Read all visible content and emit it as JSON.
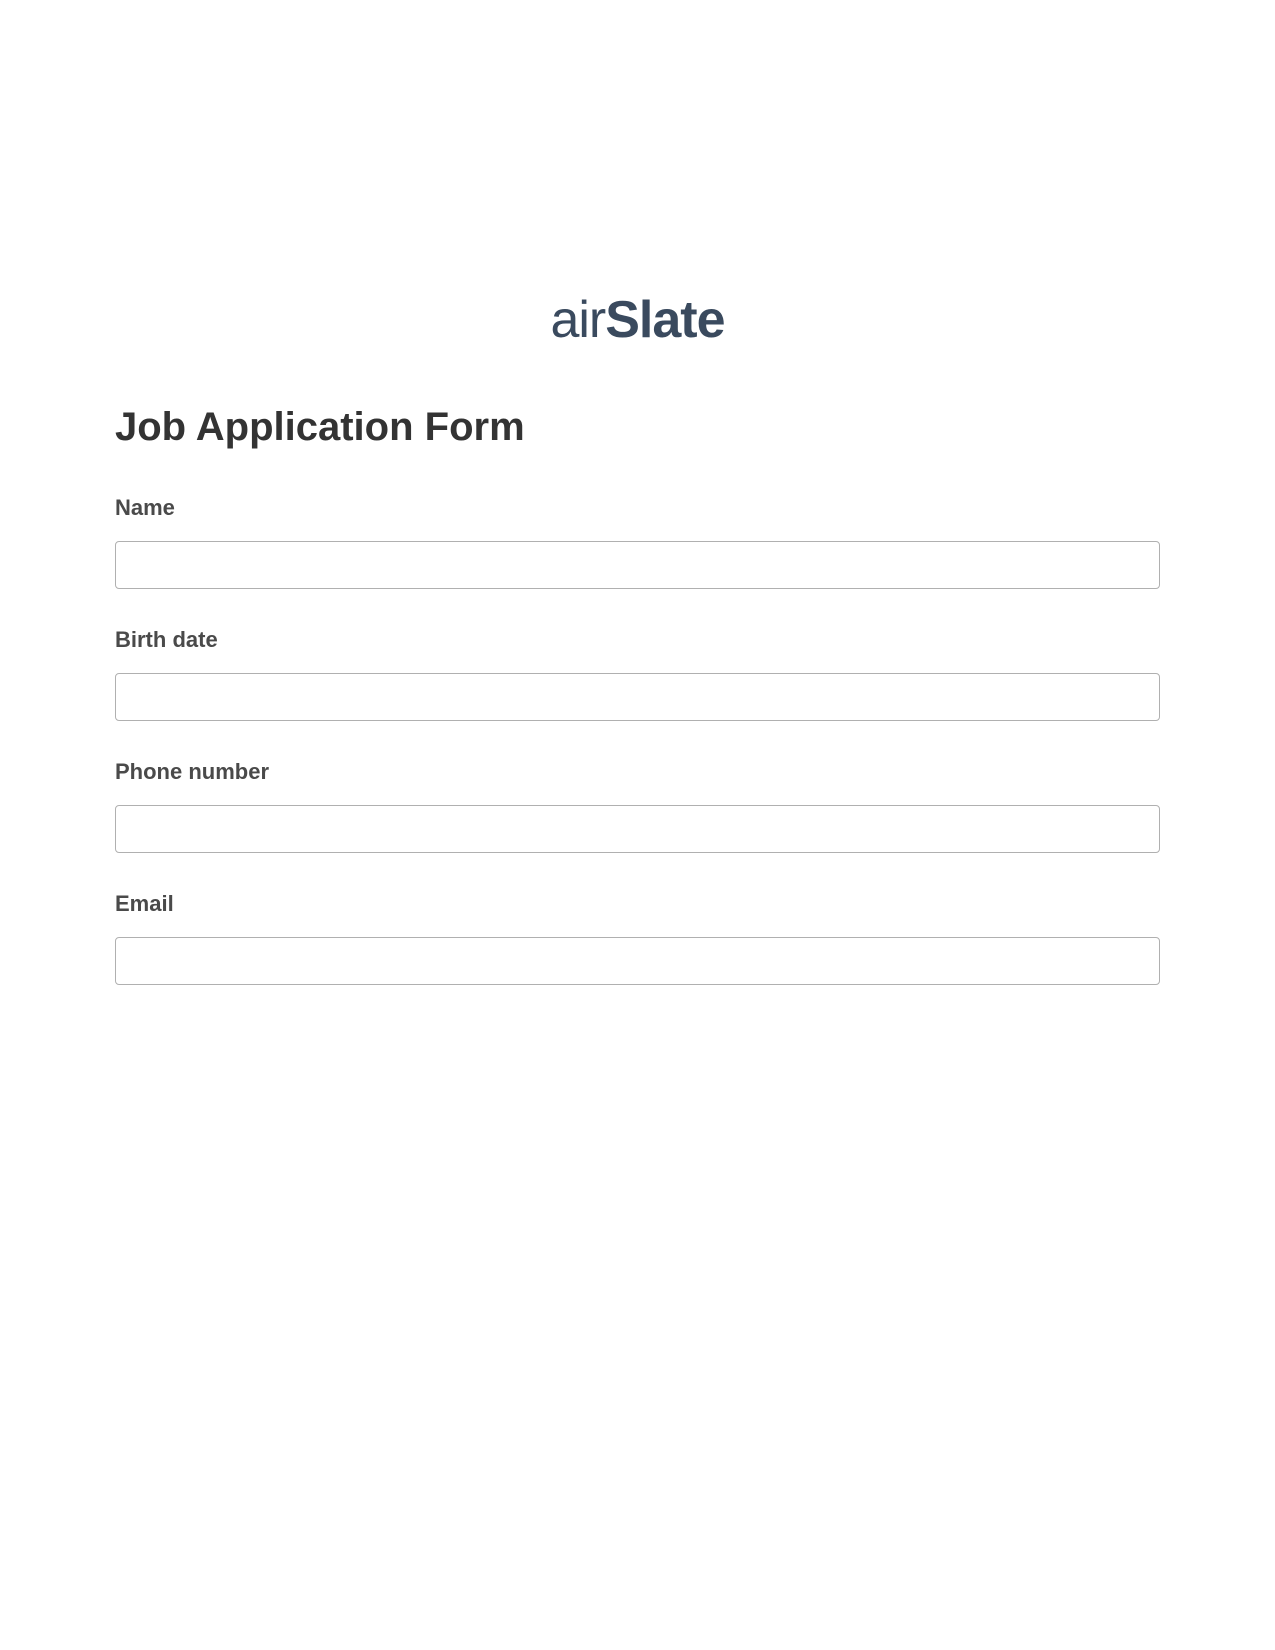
{
  "logo": {
    "prefix": "air",
    "suffix": "Slate"
  },
  "form": {
    "title": "Job Application Form",
    "fields": [
      {
        "label": "Name",
        "value": ""
      },
      {
        "label": "Birth date",
        "value": ""
      },
      {
        "label": "Phone number",
        "value": ""
      },
      {
        "label": "Email",
        "value": ""
      }
    ]
  }
}
